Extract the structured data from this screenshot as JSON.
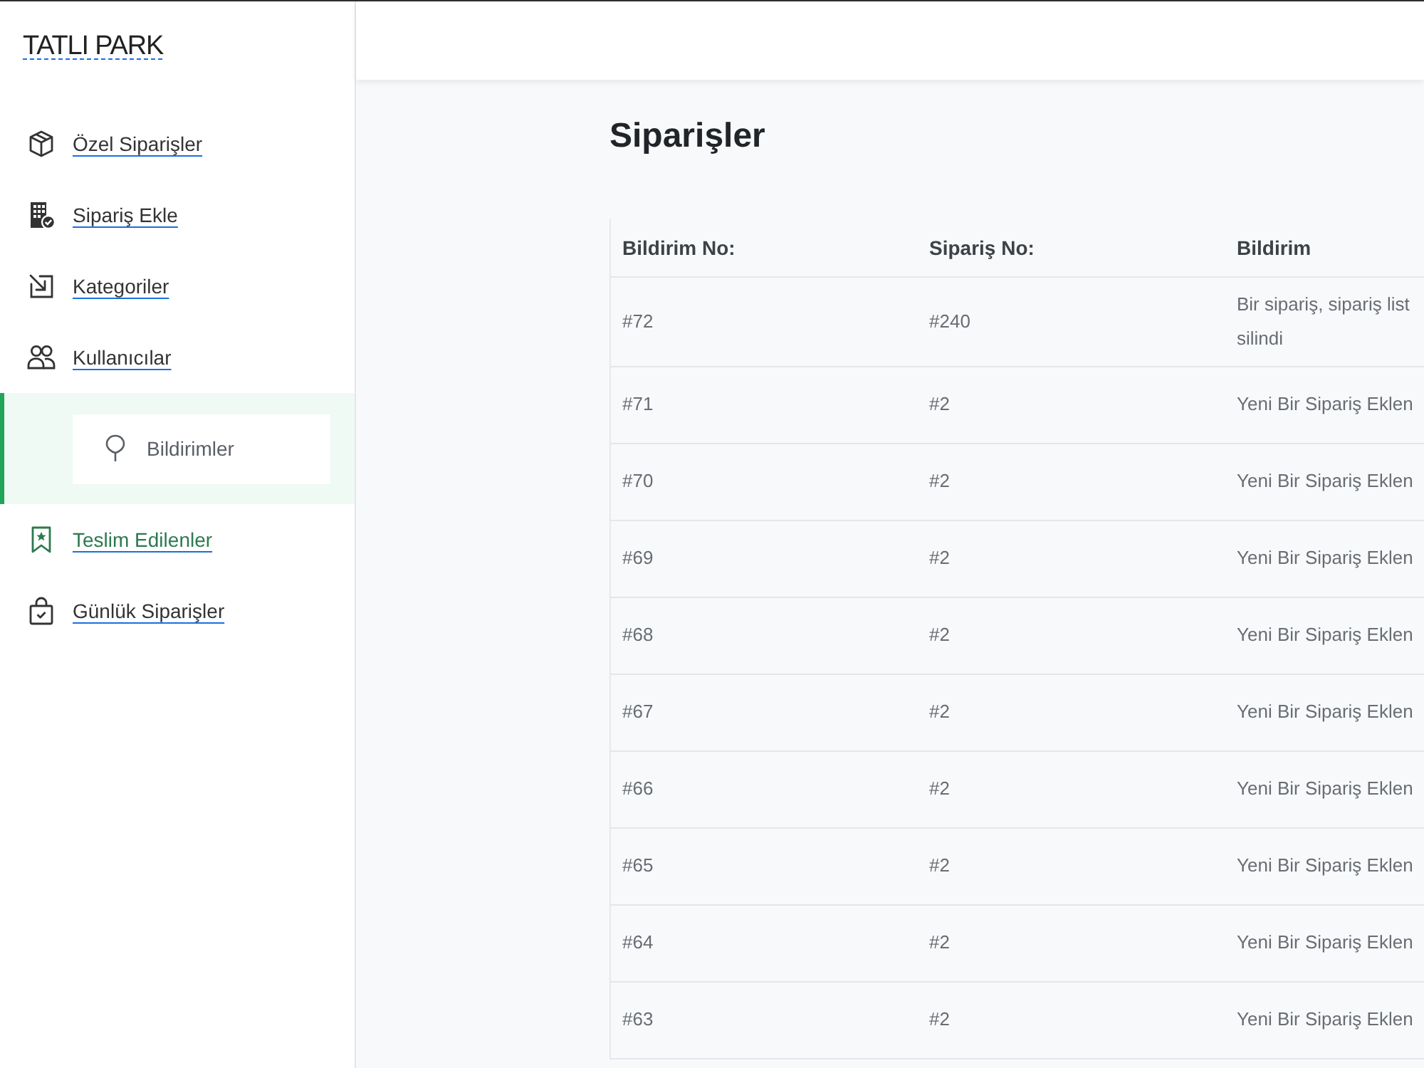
{
  "sidebar": {
    "logo": "TATLI PARK",
    "items": [
      {
        "label": "Özel Siparişler",
        "selected": false,
        "hovered": false
      },
      {
        "label": "Sipariş Ekle",
        "selected": false,
        "hovered": false
      },
      {
        "label": "Kategoriler",
        "selected": false,
        "hovered": false
      },
      {
        "label": "Kullanıcılar",
        "selected": false,
        "hovered": false
      },
      {
        "label": "Bildirimler",
        "selected": true,
        "hovered": false
      },
      {
        "label": "Teslim Edilenler",
        "selected": false,
        "hovered": true
      },
      {
        "label": "Günlük Siparişler",
        "selected": false,
        "hovered": false
      }
    ]
  },
  "page": {
    "title": "Siparişler"
  },
  "table": {
    "columns": [
      "Bildirim No:",
      "Sipariş No:",
      "Bildirim"
    ],
    "rows": [
      [
        "#72",
        "#240",
        "Bir sipariş, sipariş list\nsilindi"
      ],
      [
        "#71",
        "#2",
        "Yeni Bir Sipariş Eklen"
      ],
      [
        "#70",
        "#2",
        "Yeni Bir Sipariş Eklen"
      ],
      [
        "#69",
        "#2",
        "Yeni Bir Sipariş Eklen"
      ],
      [
        "#68",
        "#2",
        "Yeni Bir Sipariş Eklen"
      ],
      [
        "#67",
        "#2",
        "Yeni Bir Sipariş Eklen"
      ],
      [
        "#66",
        "#2",
        "Yeni Bir Sipariş Eklen"
      ],
      [
        "#65",
        "#2",
        "Yeni Bir Sipariş Eklen"
      ],
      [
        "#64",
        "#2",
        "Yeni Bir Sipariş Eklen"
      ],
      [
        "#63",
        "#2",
        "Yeni Bir Sipariş Eklen"
      ]
    ]
  }
}
